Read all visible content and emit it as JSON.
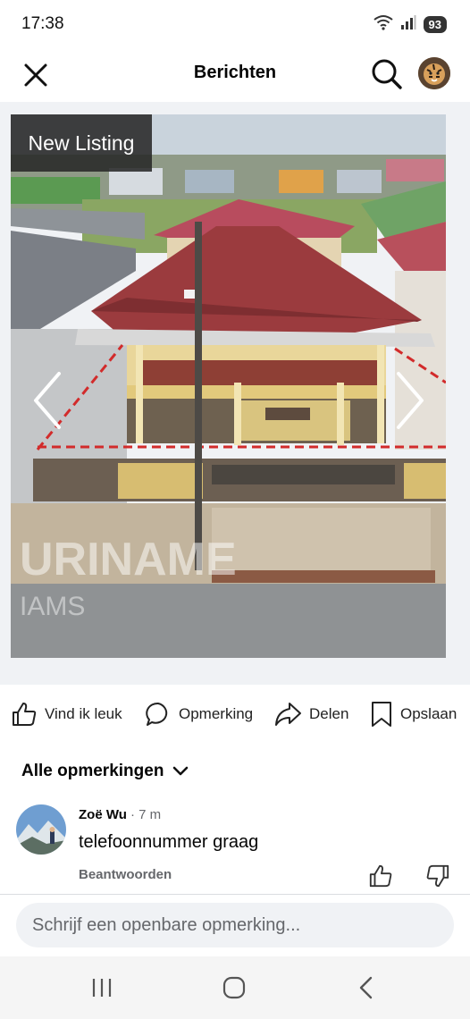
{
  "status": {
    "time": "17:38",
    "battery": "93"
  },
  "header": {
    "title": "Berichten"
  },
  "post": {
    "badge": "New Listing",
    "watermark": "URINAME",
    "watermark2": "IAMS"
  },
  "actions": {
    "like": "Vind ik leuk",
    "comment": "Opmerking",
    "share": "Delen",
    "save": "Opslaan"
  },
  "comments": {
    "filter_label": "Alle opmerkingen",
    "items": [
      {
        "author": "Zoë Wu",
        "time": "· 7 m",
        "text": "telefoonnummer graag",
        "reply": "Beantwoorden"
      }
    ]
  },
  "composer": {
    "placeholder": "Schrijf een openbare opmerking..."
  }
}
